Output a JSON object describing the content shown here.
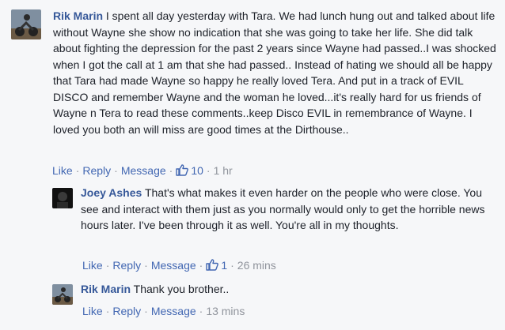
{
  "comments": [
    {
      "author": "Rik Marin",
      "text": "I spent all day yesterday with Tara. We had lunch hung out and talked about life without Wayne she show no indication that she was going to take her life. She did talk about fighting the depression for the past 2 years since Wayne had passed..I was shocked when I got the call at 1 am that she had passed.. Instead of hating we should all be happy that Tara had made Wayne so happy he really loved Tera. And put in a track of EVIL DISCO and remember Wayne and the woman he loved...it's really hard for us friends of Wayne n Tera to read these comments..keep Disco EVIL in remembrance of Wayne. I loved you both an will miss are good times at the Dirthouse..",
      "like": "Like",
      "reply": "Reply",
      "message": "Message",
      "likes": "10",
      "time": "1 hr"
    },
    {
      "author": "Joey Ashes",
      "text": "That's what makes it even harder on the people who were close. You see and interact with them just as you normally would only to get the horrible news hours later. I've been through it as well. You're all in my thoughts.",
      "like": "Like",
      "reply": "Reply",
      "message": "Message",
      "likes": "1",
      "time": "26 mins"
    },
    {
      "author": "Rik Marin",
      "text": "Thank you brother..",
      "like": "Like",
      "reply": "Reply",
      "message": "Message",
      "time": "13 mins"
    }
  ],
  "colors": {
    "author": "#365899",
    "link": "#4267b2",
    "meta": "#90949c",
    "background": "#f6f7f9"
  }
}
